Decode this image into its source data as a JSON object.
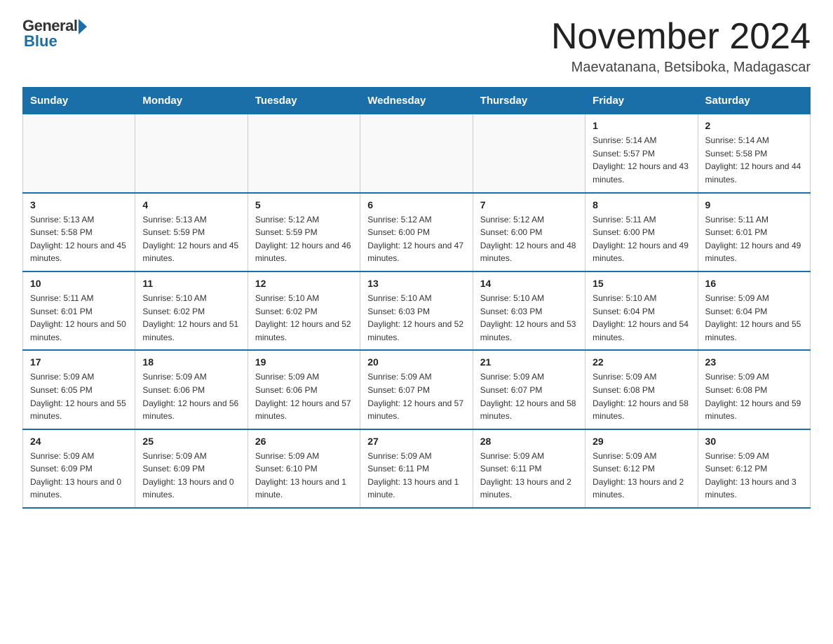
{
  "logo": {
    "general": "General",
    "blue": "Blue"
  },
  "title": "November 2024",
  "location": "Maevatanana, Betsiboka, Madagascar",
  "weekdays": [
    "Sunday",
    "Monday",
    "Tuesday",
    "Wednesday",
    "Thursday",
    "Friday",
    "Saturday"
  ],
  "weeks": [
    [
      {
        "day": "",
        "detail": ""
      },
      {
        "day": "",
        "detail": ""
      },
      {
        "day": "",
        "detail": ""
      },
      {
        "day": "",
        "detail": ""
      },
      {
        "day": "",
        "detail": ""
      },
      {
        "day": "1",
        "detail": "Sunrise: 5:14 AM\nSunset: 5:57 PM\nDaylight: 12 hours and 43 minutes."
      },
      {
        "day": "2",
        "detail": "Sunrise: 5:14 AM\nSunset: 5:58 PM\nDaylight: 12 hours and 44 minutes."
      }
    ],
    [
      {
        "day": "3",
        "detail": "Sunrise: 5:13 AM\nSunset: 5:58 PM\nDaylight: 12 hours and 45 minutes."
      },
      {
        "day": "4",
        "detail": "Sunrise: 5:13 AM\nSunset: 5:59 PM\nDaylight: 12 hours and 45 minutes."
      },
      {
        "day": "5",
        "detail": "Sunrise: 5:12 AM\nSunset: 5:59 PM\nDaylight: 12 hours and 46 minutes."
      },
      {
        "day": "6",
        "detail": "Sunrise: 5:12 AM\nSunset: 6:00 PM\nDaylight: 12 hours and 47 minutes."
      },
      {
        "day": "7",
        "detail": "Sunrise: 5:12 AM\nSunset: 6:00 PM\nDaylight: 12 hours and 48 minutes."
      },
      {
        "day": "8",
        "detail": "Sunrise: 5:11 AM\nSunset: 6:00 PM\nDaylight: 12 hours and 49 minutes."
      },
      {
        "day": "9",
        "detail": "Sunrise: 5:11 AM\nSunset: 6:01 PM\nDaylight: 12 hours and 49 minutes."
      }
    ],
    [
      {
        "day": "10",
        "detail": "Sunrise: 5:11 AM\nSunset: 6:01 PM\nDaylight: 12 hours and 50 minutes."
      },
      {
        "day": "11",
        "detail": "Sunrise: 5:10 AM\nSunset: 6:02 PM\nDaylight: 12 hours and 51 minutes."
      },
      {
        "day": "12",
        "detail": "Sunrise: 5:10 AM\nSunset: 6:02 PM\nDaylight: 12 hours and 52 minutes."
      },
      {
        "day": "13",
        "detail": "Sunrise: 5:10 AM\nSunset: 6:03 PM\nDaylight: 12 hours and 52 minutes."
      },
      {
        "day": "14",
        "detail": "Sunrise: 5:10 AM\nSunset: 6:03 PM\nDaylight: 12 hours and 53 minutes."
      },
      {
        "day": "15",
        "detail": "Sunrise: 5:10 AM\nSunset: 6:04 PM\nDaylight: 12 hours and 54 minutes."
      },
      {
        "day": "16",
        "detail": "Sunrise: 5:09 AM\nSunset: 6:04 PM\nDaylight: 12 hours and 55 minutes."
      }
    ],
    [
      {
        "day": "17",
        "detail": "Sunrise: 5:09 AM\nSunset: 6:05 PM\nDaylight: 12 hours and 55 minutes."
      },
      {
        "day": "18",
        "detail": "Sunrise: 5:09 AM\nSunset: 6:06 PM\nDaylight: 12 hours and 56 minutes."
      },
      {
        "day": "19",
        "detail": "Sunrise: 5:09 AM\nSunset: 6:06 PM\nDaylight: 12 hours and 57 minutes."
      },
      {
        "day": "20",
        "detail": "Sunrise: 5:09 AM\nSunset: 6:07 PM\nDaylight: 12 hours and 57 minutes."
      },
      {
        "day": "21",
        "detail": "Sunrise: 5:09 AM\nSunset: 6:07 PM\nDaylight: 12 hours and 58 minutes."
      },
      {
        "day": "22",
        "detail": "Sunrise: 5:09 AM\nSunset: 6:08 PM\nDaylight: 12 hours and 58 minutes."
      },
      {
        "day": "23",
        "detail": "Sunrise: 5:09 AM\nSunset: 6:08 PM\nDaylight: 12 hours and 59 minutes."
      }
    ],
    [
      {
        "day": "24",
        "detail": "Sunrise: 5:09 AM\nSunset: 6:09 PM\nDaylight: 13 hours and 0 minutes."
      },
      {
        "day": "25",
        "detail": "Sunrise: 5:09 AM\nSunset: 6:09 PM\nDaylight: 13 hours and 0 minutes."
      },
      {
        "day": "26",
        "detail": "Sunrise: 5:09 AM\nSunset: 6:10 PM\nDaylight: 13 hours and 1 minute."
      },
      {
        "day": "27",
        "detail": "Sunrise: 5:09 AM\nSunset: 6:11 PM\nDaylight: 13 hours and 1 minute."
      },
      {
        "day": "28",
        "detail": "Sunrise: 5:09 AM\nSunset: 6:11 PM\nDaylight: 13 hours and 2 minutes."
      },
      {
        "day": "29",
        "detail": "Sunrise: 5:09 AM\nSunset: 6:12 PM\nDaylight: 13 hours and 2 minutes."
      },
      {
        "day": "30",
        "detail": "Sunrise: 5:09 AM\nSunset: 6:12 PM\nDaylight: 13 hours and 3 minutes."
      }
    ]
  ]
}
